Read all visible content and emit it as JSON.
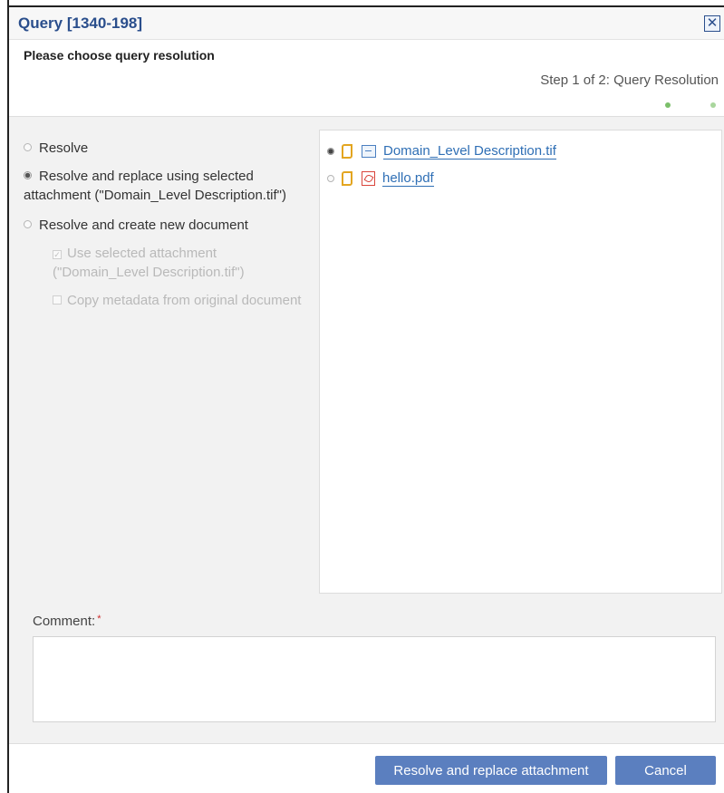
{
  "dialog": {
    "title": "Query [1340-198]",
    "close_glyph": "✕",
    "prompt": "Please choose query resolution",
    "step_text": "Step 1 of 2: Query Resolution"
  },
  "options": {
    "resolve": "Resolve",
    "resolve_replace": "Resolve and replace using selected attachment (\"Domain_Level Description.tif\")",
    "resolve_create": "Resolve and create new document",
    "use_selected": "Use selected attachment (\"Domain_Level Description.tif\")",
    "copy_metadata": "Copy metadata from original document",
    "selected": "resolve_replace"
  },
  "attachments": [
    {
      "name": "Domain_Level Description.tif",
      "type_icon": "image-file-icon",
      "selected": true
    },
    {
      "name": "hello.pdf",
      "type_icon": "pdf-file-icon",
      "selected": false
    }
  ],
  "comment": {
    "label": "Comment:",
    "required_mark": "*",
    "value": ""
  },
  "buttons": {
    "primary": "Resolve and replace attachment",
    "cancel": "Cancel"
  },
  "colors": {
    "title": "#2a4e8c",
    "button_bg": "#5b7fbf",
    "link": "#2f6fb5",
    "step_dot_active": "#7bbf6a"
  }
}
